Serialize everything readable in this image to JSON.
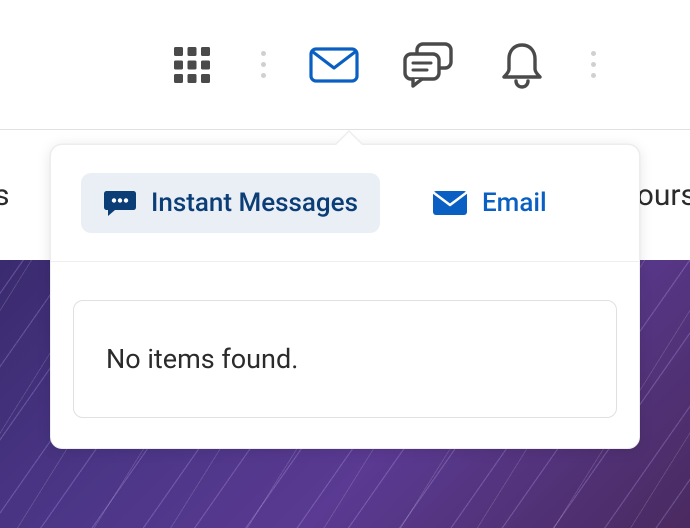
{
  "topbar": {
    "icons": {
      "apps": "apps-grid",
      "mail": "mail",
      "chat": "chat",
      "bell": "bell"
    }
  },
  "dropdown": {
    "tabs": {
      "instant": {
        "label": "Instant Messages"
      },
      "email": {
        "label": "Email"
      }
    },
    "empty_text": "No items found."
  },
  "background": {
    "left_fragment": "s",
    "right_fragment": "ours"
  },
  "colors": {
    "accent_blue": "#0a60c2",
    "dark_navy": "#0b3e77",
    "icon_gray": "#4a4a4a"
  }
}
